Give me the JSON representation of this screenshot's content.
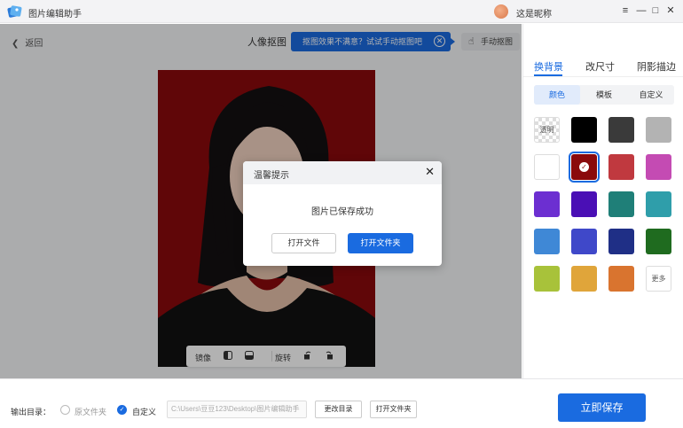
{
  "titlebar": {
    "app_title": "图片编辑助手",
    "user_name": "这是昵称",
    "controls": [
      "≡",
      "—",
      "□",
      "✕"
    ]
  },
  "topbar": {
    "back_label": "返回",
    "section_title": "人像抠图",
    "tip_text": "抠图效果不满意？试试手动抠图吧",
    "tip_close": "✕",
    "manual_label": "手动抠图"
  },
  "photo": {
    "background_color": "#8a0a0c"
  },
  "tools": {
    "mirror_label": "镜像",
    "rotate_label": "旋转"
  },
  "right_panel": {
    "tabs": [
      "换背景",
      "改尺寸",
      "阴影描边"
    ],
    "active_tab": "换背景",
    "segments": [
      "颜色",
      "模板",
      "自定义"
    ],
    "active_segment": "颜色",
    "transparent_label": "透明",
    "more_label": "更多",
    "swatches": [
      "transparent",
      "#000000",
      "#3a3a3a",
      "#b3b3b3",
      "#ffffff",
      "#8a0a0c",
      "#c0393f",
      "#c44bb3",
      "#6c2fd1",
      "#4a0fb5",
      "#1f7f78",
      "#2f9eaa",
      "#3f88d6",
      "#3f48c9",
      "#1f2f86",
      "#1f6b1f",
      "#a8c23a",
      "#e0a53a",
      "#d9742f",
      "more"
    ],
    "selected_swatch_index": 5
  },
  "bottom": {
    "output_label": "输出目录：",
    "option_original": "原文件夹",
    "option_custom": "自定义",
    "path_value": "C:\\Users\\豆豆123\\Desktop\\图片编辑助手",
    "change_dir_label": "更改目录",
    "open_folder_label": "打开文件夹",
    "save_label": "立即保存"
  },
  "dialog": {
    "title": "温馨提示",
    "close": "✕",
    "message": "图片已保存成功",
    "open_file_label": "打开文件",
    "open_folder_label": "打开文件夹"
  },
  "colors": {
    "accent": "#1a6be0"
  }
}
